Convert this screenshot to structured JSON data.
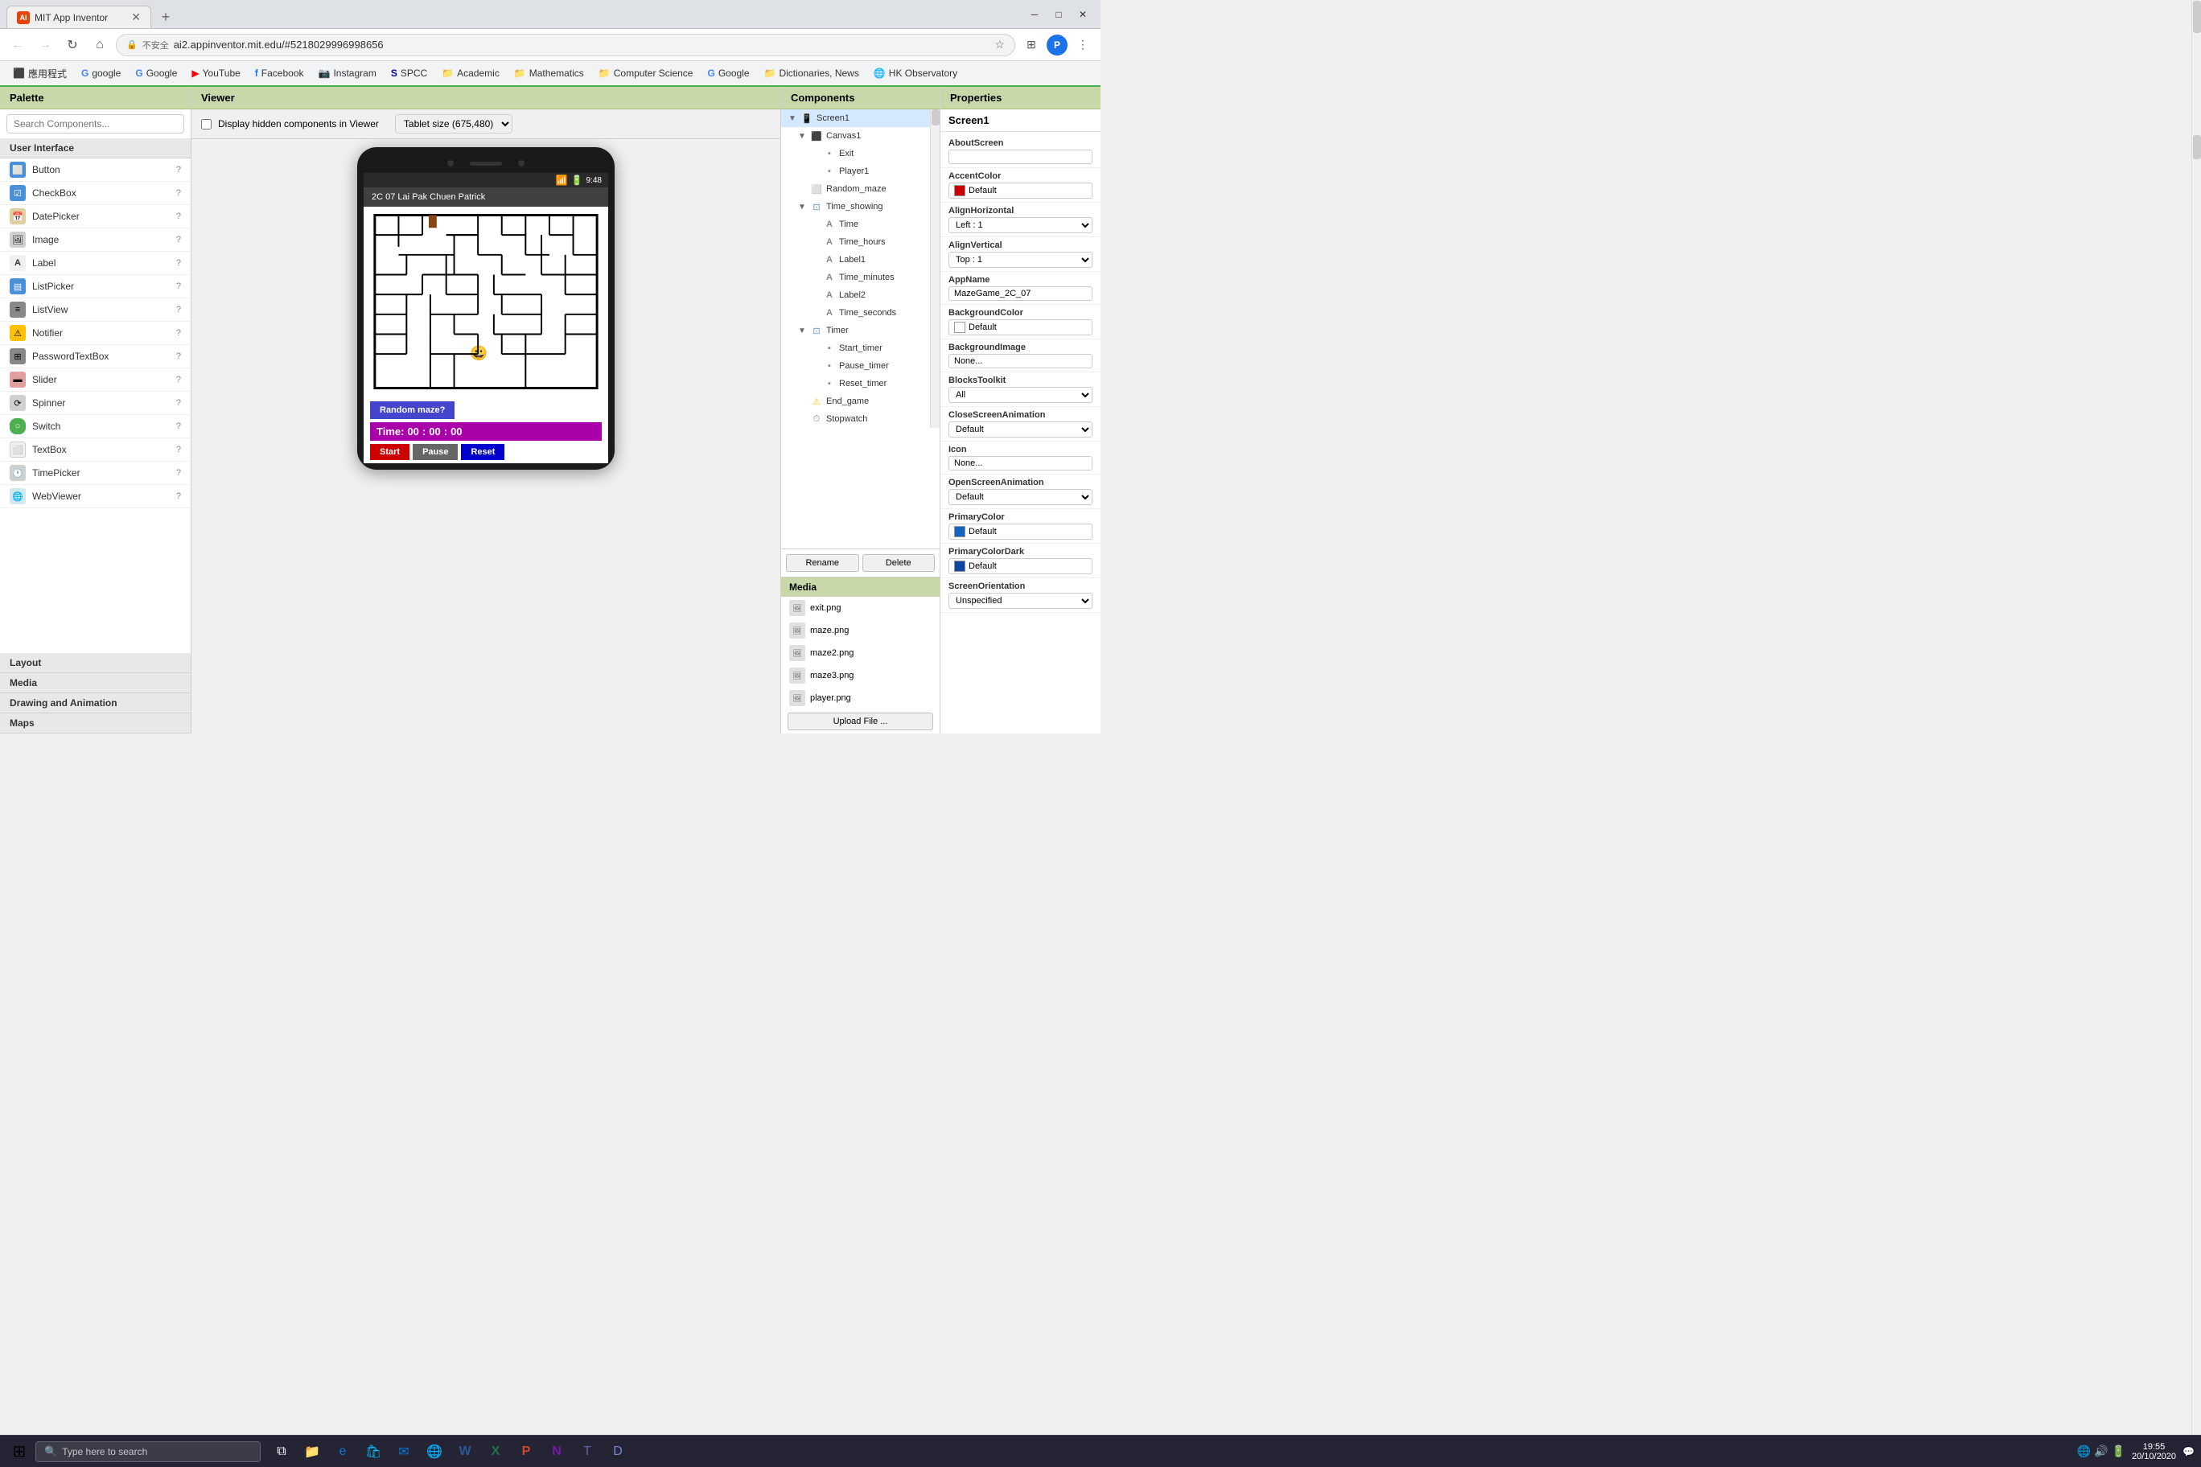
{
  "browser": {
    "tab_title": "MIT App Inventor",
    "tab_favicon": "AI",
    "url": "ai2.appinventor.mit.edu/#5218029996998656",
    "url_protocol": "不安全",
    "window_controls": {
      "minimize": "─",
      "maximize": "□",
      "close": "✕"
    }
  },
  "bookmarks": [
    {
      "label": "應用程式",
      "icon": "⬛"
    },
    {
      "label": "google",
      "icon": "G"
    },
    {
      "label": "Google",
      "icon": "G"
    },
    {
      "label": "YouTube",
      "icon": "▶"
    },
    {
      "label": "Facebook",
      "icon": "f"
    },
    {
      "label": "Instagram",
      "icon": "📷"
    },
    {
      "label": "SPCC",
      "icon": "S"
    },
    {
      "label": "Academic",
      "icon": "📁"
    },
    {
      "label": "Mathematics",
      "icon": "📁"
    },
    {
      "label": "Computer Science",
      "icon": "📁"
    },
    {
      "label": "Google",
      "icon": "G"
    },
    {
      "label": "Dictionaries, News",
      "icon": "📁"
    },
    {
      "label": "HK Observatory",
      "icon": "🌐"
    }
  ],
  "palette": {
    "header": "Palette",
    "search_placeholder": "Search Components...",
    "sections": {
      "user_interface": "User Interface",
      "layout": "Layout",
      "media": "Media",
      "drawing_animation": "Drawing and Animation",
      "maps": "Maps"
    },
    "components": [
      {
        "name": "Button",
        "icon": "⬜"
      },
      {
        "name": "CheckBox",
        "icon": "☑"
      },
      {
        "name": "DatePicker",
        "icon": "📅"
      },
      {
        "name": "Image",
        "icon": "🖼"
      },
      {
        "name": "Label",
        "icon": "A"
      },
      {
        "name": "ListPicker",
        "icon": "📋"
      },
      {
        "name": "ListView",
        "icon": "≡"
      },
      {
        "name": "Notifier",
        "icon": "⚠"
      },
      {
        "name": "PasswordTextBox",
        "icon": "⊞"
      },
      {
        "name": "Slider",
        "icon": "▬"
      },
      {
        "name": "Spinner",
        "icon": "⟳"
      },
      {
        "name": "Switch",
        "icon": "⊙"
      },
      {
        "name": "TextBox",
        "icon": "⬜"
      },
      {
        "name": "TimePicker",
        "icon": "🕐"
      },
      {
        "name": "WebViewer",
        "icon": "🌐"
      }
    ]
  },
  "viewer": {
    "header": "Viewer",
    "checkbox_label": "Display hidden components in Viewer",
    "size_dropdown": "Tablet size (675,480)",
    "phone_title": "2C 07 Lai Pak Chuen Patrick",
    "phone_time": "9:48",
    "random_maze_btn": "Random maze?",
    "timer_label": "Time:",
    "timer_h": "00",
    "timer_colon1": ":",
    "timer_m": "00",
    "timer_colon2": ":",
    "timer_s": "00",
    "start_btn": "Start",
    "pause_btn": "Pause",
    "reset_btn": "Reset"
  },
  "components": {
    "header": "Components",
    "screen1": "Screen1",
    "canvas1": "Canvas1",
    "exit": "Exit",
    "player1": "Player1",
    "random_maze": "Random_maze",
    "time_showing": "Time_showing",
    "time": "Time",
    "time_hours": "Time_hours",
    "label1": "Label1",
    "time_minutes": "Time_minutes",
    "label2": "Label2",
    "time_seconds": "Time_seconds",
    "timer": "Timer",
    "start_timer": "Start_timer",
    "pause_timer": "Pause_timer",
    "reset_timer": "Reset_timer",
    "end_game": "End_game",
    "stopwatch": "Stopwatch",
    "rename_btn": "Rename",
    "delete_btn": "Delete"
  },
  "media": {
    "header": "Media",
    "files": [
      "exit.png",
      "maze.png",
      "maze2.png",
      "maze3.png",
      "player.png"
    ],
    "upload_btn": "Upload File ..."
  },
  "properties": {
    "header": "Properties",
    "screen_title": "Screen1",
    "about_screen_label": "AboutScreen",
    "accent_color_label": "AccentColor",
    "accent_color_value": "Default",
    "accent_color_swatch": "#cc0000",
    "align_horizontal_label": "AlignHorizontal",
    "align_horizontal_value": "Left : 1",
    "align_vertical_label": "AlignVertical",
    "align_vertical_value": "Top : 1",
    "app_name_label": "AppName",
    "app_name_value": "MazeGame_2C_07",
    "background_color_label": "BackgroundColor",
    "background_color_value": "Default",
    "background_color_swatch": "#ffffff",
    "background_image_label": "BackgroundImage",
    "background_image_value": "None...",
    "blocks_toolkit_label": "BlocksToolkit",
    "blocks_toolkit_value": "All",
    "close_screen_animation_label": "CloseScreenAnimation",
    "close_screen_animation_value": "Default",
    "icon_label": "Icon",
    "icon_value": "None...",
    "open_screen_animation_label": "OpenScreenAnimation",
    "open_screen_animation_value": "Default",
    "primary_color_label": "PrimaryColor",
    "primary_color_value": "Default",
    "primary_color_swatch": "#1565c0",
    "primary_color_dark_label": "PrimaryColorDark",
    "primary_color_dark_value": "Default",
    "primary_color_dark_swatch": "#0d47a1",
    "screen_orientation_label": "ScreenOrientation",
    "screen_orientation_value": "Unspecified"
  },
  "taskbar": {
    "search_placeholder": "Type here to search",
    "time": "19:55",
    "date": "20/10/2020",
    "layout_icon": "⊞",
    "notification_count": ""
  }
}
